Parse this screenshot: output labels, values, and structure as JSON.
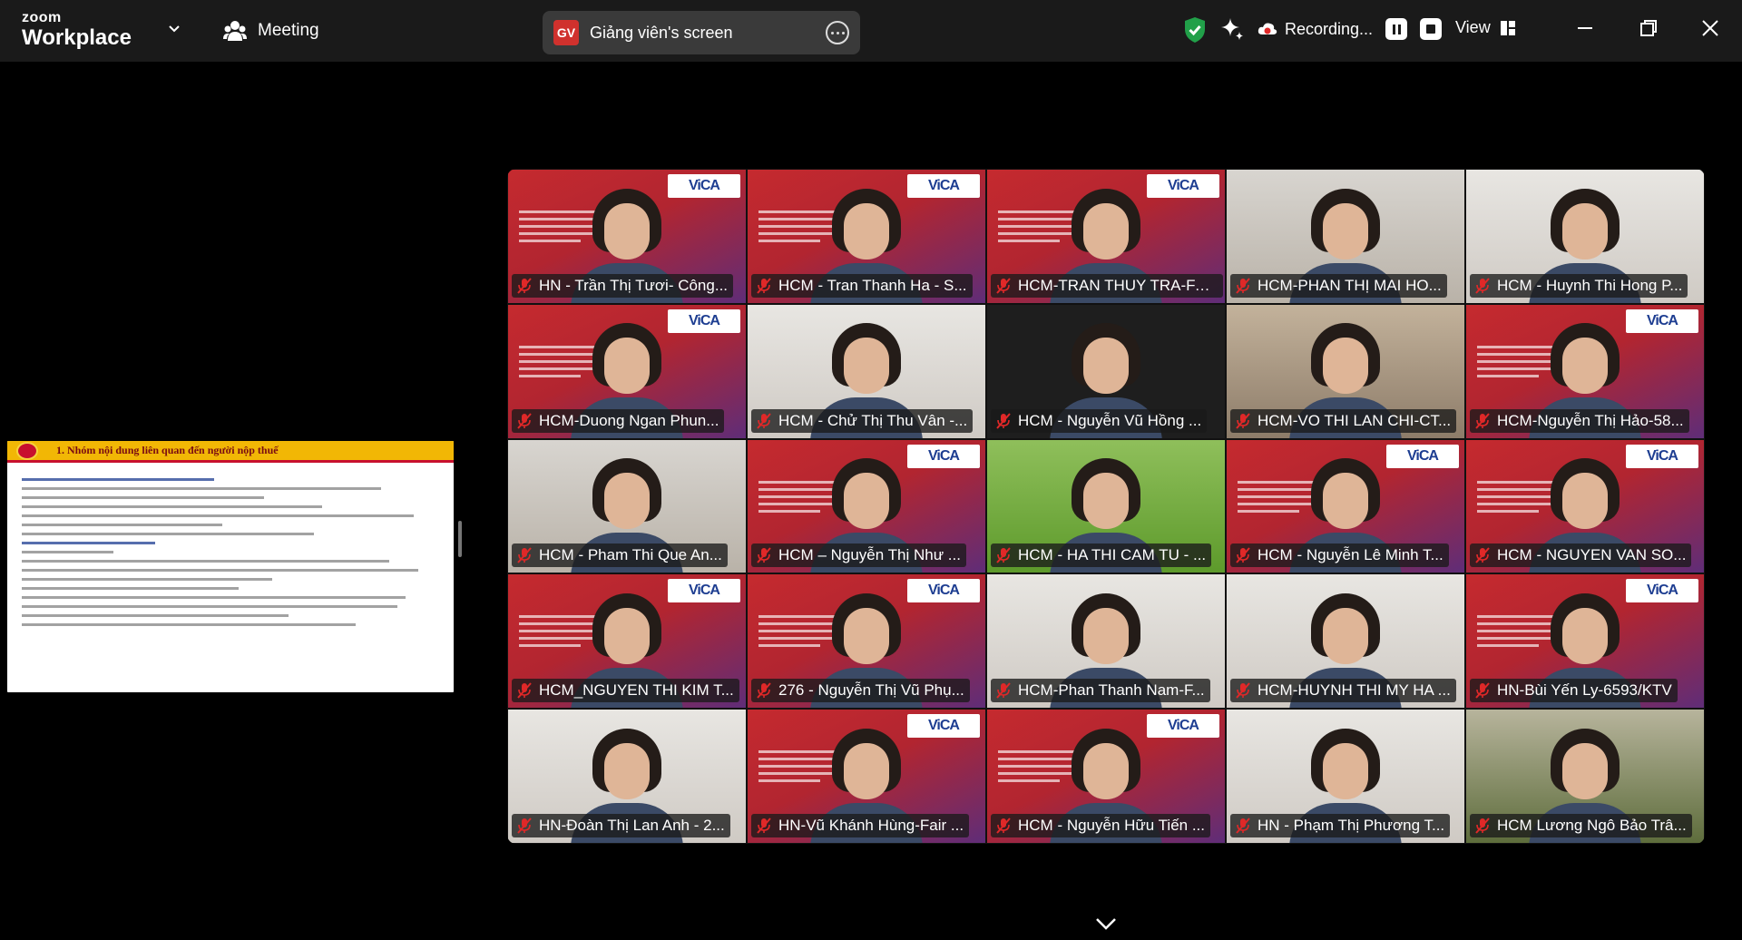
{
  "app": {
    "brand_line1": "zoom",
    "brand_line2": "Workplace"
  },
  "toolbar": {
    "meeting_label": "Meeting",
    "share_badge": "GV",
    "share_label": "Giảng viên's screen",
    "recording_label": "Recording...",
    "view_label": "View"
  },
  "slide": {
    "title": "1. Nhóm nội dung liên quan đến người nộp thuế"
  },
  "participants": [
    {
      "name": "HN - Trần Thị Tươi- Công...",
      "bg": "slide"
    },
    {
      "name": "HCM - Tran Thanh Ha - S...",
      "bg": "slide"
    },
    {
      "name": "HCM-TRAN THUY TRA-FA...",
      "bg": "slide"
    },
    {
      "name": "HCM-PHAN THỊ MAI HO...",
      "bg": "room1"
    },
    {
      "name": "HCM - Huynh Thi Hong P...",
      "bg": "room2"
    },
    {
      "name": "HCM-Duong Ngan Phun...",
      "bg": "slide"
    },
    {
      "name": "HCM - Chử Thị Thu Vân -...",
      "bg": "room2"
    },
    {
      "name": "HCM - Nguyễn Vũ Hồng ...",
      "bg": "dark"
    },
    {
      "name": "HCM-VO THI LAN CHI-CT...",
      "bg": "room3"
    },
    {
      "name": "HCM-Nguyễn Thị Hảo-58...",
      "bg": "slide"
    },
    {
      "name": "HCM - Pham Thi Que An...",
      "bg": "room1"
    },
    {
      "name": "HCM – Nguyễn Thị Như ...",
      "bg": "slide"
    },
    {
      "name": "HCM - HA THI CAM TU - ...",
      "bg": "grass"
    },
    {
      "name": "HCM - Nguyễn Lê Minh T...",
      "bg": "slide"
    },
    {
      "name": "HCM - NGUYEN VAN SO...",
      "bg": "slide"
    },
    {
      "name": "HCM_NGUYEN THI KIM T...",
      "bg": "slide"
    },
    {
      "name": "276 - Nguyễn Thị Vũ Phụ...",
      "bg": "slide"
    },
    {
      "name": "HCM-Phan Thanh Nam-F...",
      "bg": "room2"
    },
    {
      "name": "HCM-HUYNH THI MY HA ...",
      "bg": "room2"
    },
    {
      "name": "HN-Bùi Yến Ly-6593/KTV",
      "bg": "slide"
    },
    {
      "name": "HN-Đoàn Thị Lan Anh - 2...",
      "bg": "room2"
    },
    {
      "name": "HN-Vũ Khánh Hùng-Fair ...",
      "bg": "slide"
    },
    {
      "name": "HCM - Nguyễn Hữu Tiến ...",
      "bg": "slide"
    },
    {
      "name": "HN - Phạm Thị Phương T...",
      "bg": "room2"
    },
    {
      "name": "HCM Lương Ngô Bảo Trâ...",
      "bg": "plant"
    }
  ],
  "vica_text": "ViCA"
}
